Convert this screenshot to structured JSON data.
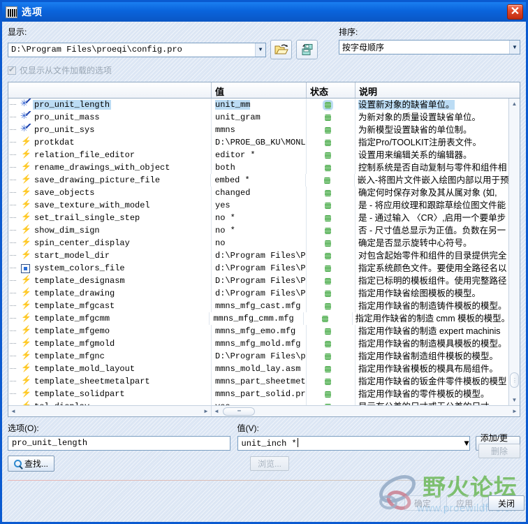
{
  "window": {
    "title": "选项",
    "icon": "options-app-icon",
    "close_label": "✕"
  },
  "toolbar": {
    "display_label": "显示:",
    "display_value": "D:\\Program Files\\proeqi\\config.pro",
    "open_icon": "open-folder-icon",
    "save_icon": "save-floppy-icon",
    "sort_label": "排序:",
    "sort_value": "按字母顺序",
    "filter_checkbox_label": "仅显示从文件加载的选项",
    "filter_checkbox_checked": true,
    "filter_checkbox_disabled": true
  },
  "table": {
    "headers": [
      "",
      "值",
      "状态",
      "说明"
    ],
    "rows": [
      {
        "icon": "star-pen-icon",
        "name": "pro_unit_length",
        "value": "unit_mm",
        "status": "green-dot",
        "desc": "设置新对象的缺省单位。",
        "selected": true
      },
      {
        "icon": "star-pen-icon",
        "name": "pro_unit_mass",
        "value": "unit_gram",
        "status": "green-dot",
        "desc": "为新对象的质量设置缺省单位。",
        "selected": false
      },
      {
        "icon": "star-pen-icon",
        "name": "pro_unit_sys",
        "value": "mmns",
        "status": "green-dot",
        "desc": "为新模型设置缺省的单位制。",
        "selected": false
      },
      {
        "icon": "bolt-icon",
        "name": "protkdat",
        "value": "D:\\PROE_GB_KU\\MONL...",
        "status": "green-dot",
        "desc": "指定Pro/TOOLKIT注册表文件。",
        "selected": false
      },
      {
        "icon": "bolt-icon",
        "name": "relation_file_editor",
        "value": "editor *",
        "status": "green-dot",
        "desc": "设置用来编辑关系的编辑器。",
        "selected": false
      },
      {
        "icon": "bolt-icon",
        "name": "rename_drawings_with_object",
        "value": "both",
        "status": "green-dot",
        "desc": "控制系统是否自动复制与零件和组件相",
        "selected": false
      },
      {
        "icon": "bolt-icon",
        "name": "save_drawing_picture_file",
        "value": "embed *",
        "status": "green-dot",
        "desc": "嵌入-将图片文件嵌入绘图内部以用于预",
        "selected": false
      },
      {
        "icon": "bolt-icon",
        "name": "save_objects",
        "value": "changed",
        "status": "green-dot",
        "desc": "确定何时保存对象及其从属对象 (如,",
        "selected": false
      },
      {
        "icon": "bolt-icon",
        "name": "save_texture_with_model",
        "value": "yes",
        "status": "green-dot",
        "desc": "是 - 将应用纹理和跟踪草绘位图文件能",
        "selected": false
      },
      {
        "icon": "bolt-icon",
        "name": "set_trail_single_step",
        "value": "no *",
        "status": "green-dot",
        "desc": "是 - 通过输入 〈CR〉,启用一个要单步",
        "selected": false
      },
      {
        "icon": "bolt-icon",
        "name": "show_dim_sign",
        "value": "no *",
        "status": "green-dot",
        "desc": "否 - 尺寸值总显示为正值。负数在另一",
        "selected": false
      },
      {
        "icon": "bolt-icon",
        "name": "spin_center_display",
        "value": "no",
        "status": "green-dot",
        "desc": "确定是否显示旋转中心符号。",
        "selected": false
      },
      {
        "icon": "bolt-icon",
        "name": "start_model_dir",
        "value": "d:\\Program Files\\P...",
        "status": "green-dot",
        "desc": "对包含起始零件和组件的目录提供完全",
        "selected": false
      },
      {
        "icon": "box-icon",
        "name": "system_colors_file",
        "value": "d:\\Program Files\\P...",
        "status": "green-dot",
        "desc": "指定系统颜色文件。要使用全路径名以",
        "selected": false
      },
      {
        "icon": "bolt-icon",
        "name": "template_designasm",
        "value": "D:\\Program Files\\P...",
        "status": "green-dot",
        "desc": "指定已标明的模板组件。使用完整路径",
        "selected": false
      },
      {
        "icon": "bolt-icon",
        "name": "template_drawing",
        "value": "d:\\Program Files\\P...",
        "status": "green-dot",
        "desc": "指定用作缺省绘图模板的模型。",
        "selected": false
      },
      {
        "icon": "bolt-icon",
        "name": "template_mfgcast",
        "value": "mmns_mfg_cast.mfg",
        "status": "green-dot",
        "desc": "指定用作缺省的制造铸件模板的模型。",
        "selected": false
      },
      {
        "icon": "bolt-icon",
        "name": "template_mfgcmm",
        "value": "mmns_mfg_cmm.mfg",
        "status": "green-dot",
        "desc": "指定用作缺省的制造 cmm 模板的模型。",
        "selected": false
      },
      {
        "icon": "bolt-icon",
        "name": "template_mfgemo",
        "value": "mmns_mfg_emo.mfg",
        "status": "green-dot",
        "desc": "指定用作缺省的制造 expert machinis",
        "selected": false
      },
      {
        "icon": "bolt-icon",
        "name": "template_mfgmold",
        "value": "mmns_mfg_mold.mfg",
        "status": "green-dot",
        "desc": "指定用作缺省的制造模具模板的模型。",
        "selected": false
      },
      {
        "icon": "bolt-icon",
        "name": "template_mfgnc",
        "value": "D:\\Program Files\\p...",
        "status": "green-dot",
        "desc": "指定用作缺省制造组件模板的模型。",
        "selected": false
      },
      {
        "icon": "bolt-icon",
        "name": "template_mold_layout",
        "value": "mmns_mold_lay.asm",
        "status": "green-dot",
        "desc": "指定用作缺省模板的模具布局组件。",
        "selected": false
      },
      {
        "icon": "bolt-icon",
        "name": "template_sheetmetalpart",
        "value": "mmns_part_sheetmet...",
        "status": "green-dot",
        "desc": "指定用作缺省的钣金件零件模板的模型",
        "selected": false
      },
      {
        "icon": "bolt-icon",
        "name": "template_solidpart",
        "value": "mmns_part_solid.prt",
        "status": "green-dot",
        "desc": "指定用作缺省的零件模板的模型。",
        "selected": false
      },
      {
        "icon": "bolt-icon",
        "name": "tol_display",
        "value": "yes",
        "status": "green-dot",
        "desc": "显示有公差的尺寸或无公差的尺寸。",
        "selected": false
      }
    ]
  },
  "editor": {
    "option_label": "选项(O):",
    "option_value": "pro_unit_length",
    "value_label": "值(V):",
    "value_value": "unit_inch *",
    "add_change_label": "添加/更改",
    "find_label": "查找...",
    "find_icon": "magnifier-icon",
    "browse_label": "浏览...",
    "delete_label": "删除"
  },
  "footer": {
    "ok_label": "确定",
    "apply_label": "应用",
    "close_label": "关闭"
  },
  "watermark": {
    "text": "野火论坛",
    "url": "www.proewildfire.cn"
  }
}
